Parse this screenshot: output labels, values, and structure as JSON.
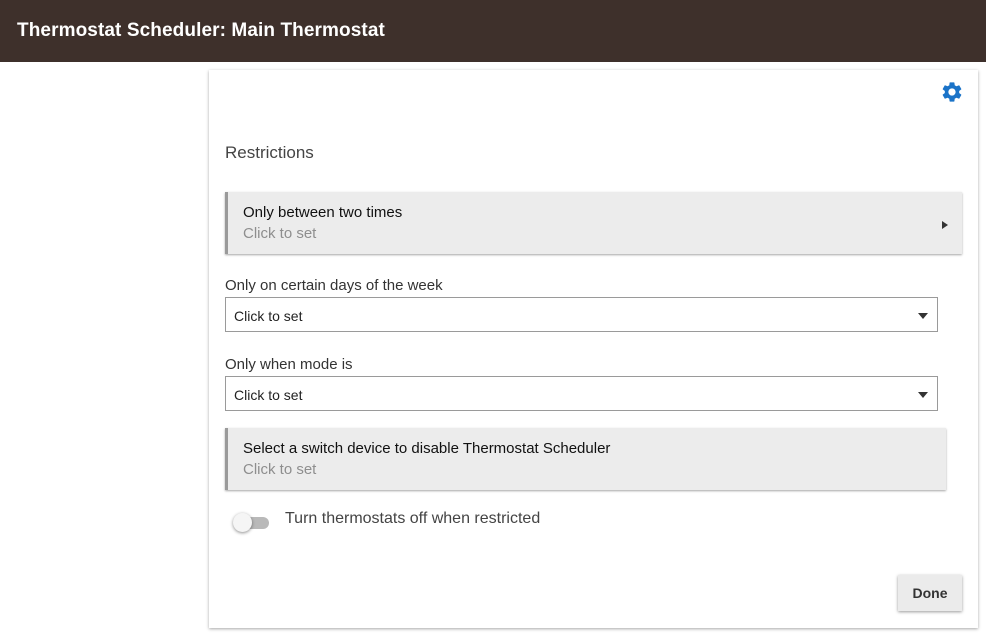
{
  "header": {
    "title": "Thermostat Scheduler: Main Thermostat"
  },
  "settings": {
    "icon": "gear-icon",
    "color": "#1a73c8"
  },
  "restrictions": {
    "title": "Restrictions",
    "time_window": {
      "title": "Only between two times",
      "value": "Click to set"
    },
    "days": {
      "label": "Only on certain days of the week",
      "value": "Click to set"
    },
    "mode": {
      "label": "Only when mode is",
      "value": "Click to set"
    },
    "switch_device": {
      "title": "Select a switch device to disable Thermostat Scheduler",
      "value": "Click to set"
    },
    "off_when_restricted": {
      "label": "Turn thermostats off when restricted",
      "enabled": false
    }
  },
  "actions": {
    "done_label": "Done"
  },
  "colors": {
    "header_bg": "#3e302b",
    "accent": "#1a73c8"
  }
}
